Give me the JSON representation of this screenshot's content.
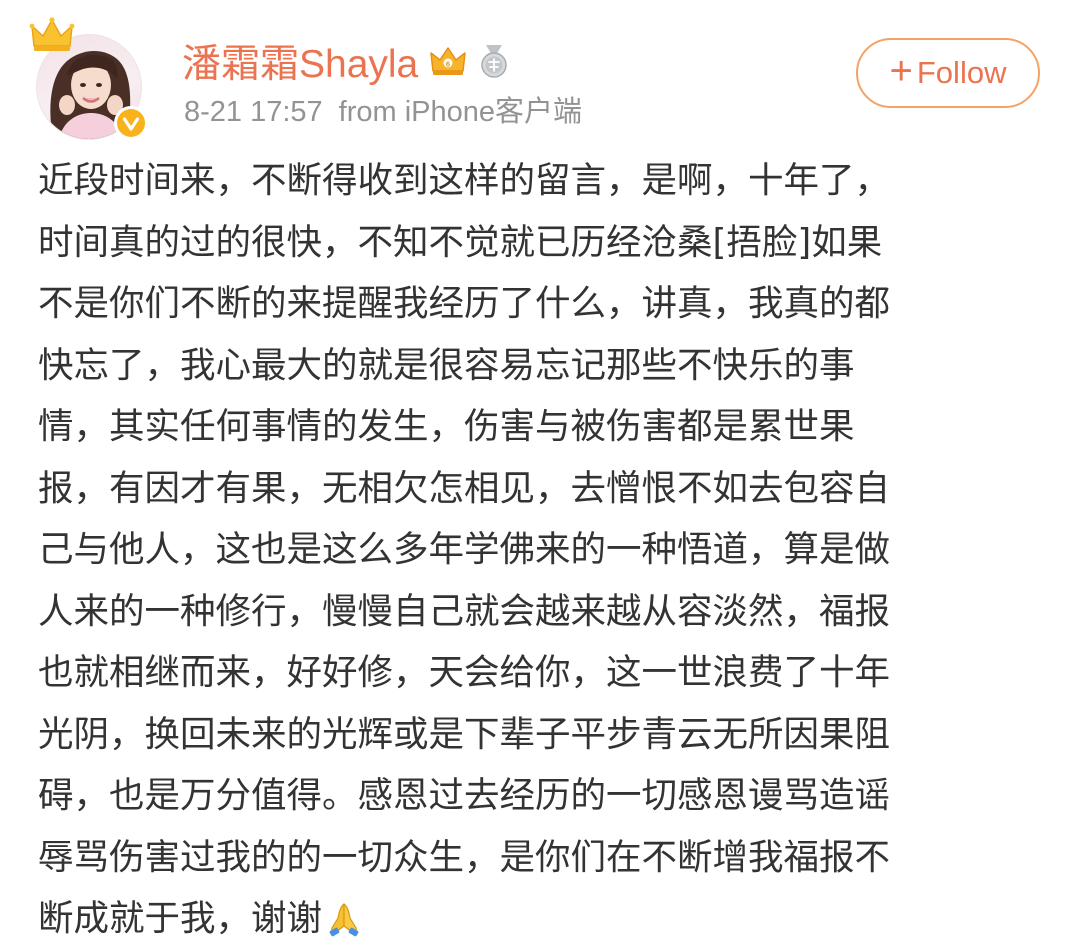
{
  "post": {
    "author": {
      "name": "潘霜霜Shayla",
      "verified": true,
      "badges": [
        "vip-crown-icon",
        "medal-icon"
      ]
    },
    "time": "8-21 17:57",
    "source": "from iPhone客户端",
    "follow_button": {
      "plus": "+",
      "label": "Follow"
    },
    "lines": [
      "近段时间来，不断得收到这样的留言，是啊，十年了，",
      "时间真的过的很快，不知不觉就已历经沧桑[捂脸]如果",
      "不是你们不断的来提醒我经历了什么，讲真，我真的都",
      "快忘了，我心最大的就是很容易忘记那些不快乐的事",
      "情，其实任何事情的发生，伤害与被伤害都是累世果",
      "报，有因才有果，无相欠怎相见，去憎恨不如去包容自",
      "己与他人，这也是这么多年学佛来的一种悟道，算是做",
      "人来的一种修行，慢慢自己就会越来越从容淡然，福报",
      "也就相继而来，好好修，天会给你，这一世浪费了十年",
      "光阴，换回未来的光辉或是下辈子平步青云无所因果阻",
      "碍，也是万分值得。感恩过去经历的一切感恩谩骂造谣",
      "辱骂伤害过我的的一切众生，是你们在不断增我福报不",
      "断成就于我，谢谢"
    ],
    "trailing_emoji": "praying-hands-icon"
  },
  "colors": {
    "accent": "#eb7350",
    "follow_border": "#f6a267",
    "meta_text": "#939393",
    "body_text": "#333333",
    "verified_badge": "#f8b21c"
  }
}
